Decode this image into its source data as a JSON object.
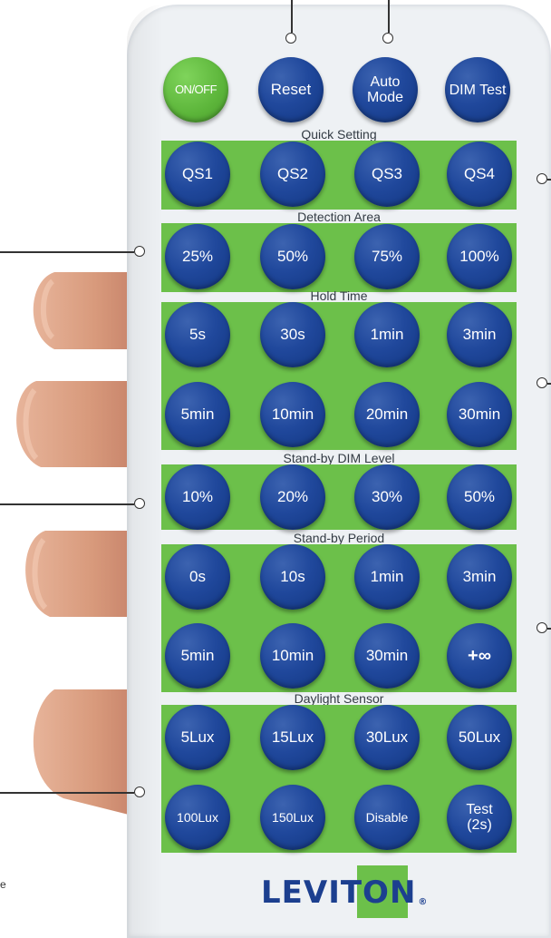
{
  "top_row": [
    {
      "label": "ON/OFF",
      "style": "green"
    },
    {
      "label": "Reset",
      "style": "blue"
    },
    {
      "label": "Auto Mode",
      "style": "blue"
    },
    {
      "label": "DIM Test",
      "style": "blue"
    }
  ],
  "sections": {
    "quick_setting": {
      "title": "Quick Setting",
      "buttons": [
        "QS1",
        "QS2",
        "QS3",
        "QS4"
      ]
    },
    "detection_area": {
      "title": "Detection Area",
      "buttons": [
        "25%",
        "50%",
        "75%",
        "100%"
      ]
    },
    "hold_time": {
      "title": "Hold Time",
      "buttons": [
        "5s",
        "30s",
        "1min",
        "3min",
        "5min",
        "10min",
        "20min",
        "30min"
      ]
    },
    "standby_dim_level": {
      "title": "Stand-by DIM Level",
      "buttons": [
        "10%",
        "20%",
        "30%",
        "50%"
      ]
    },
    "standby_period": {
      "title": "Stand-by Period",
      "buttons": [
        "0s",
        "10s",
        "1min",
        "3min",
        "5min",
        "10min",
        "30min",
        "+∞"
      ]
    },
    "daylight_sensor": {
      "title": "Daylight Sensor",
      "buttons": [
        "5Lux",
        "15Lux",
        "30Lux",
        "50Lux",
        "100Lux",
        "150Lux",
        "Disable",
        "Test (2s)"
      ]
    }
  },
  "brand": {
    "name": "LEVITON",
    "mark": "®"
  },
  "side_text": "e",
  "colors": {
    "panel_green": "#6cc04a",
    "button_blue": "#1f4699",
    "onoff_green": "#5cb53a",
    "logo_blue": "#1c3f8f",
    "remote_body": "#eef1f4"
  }
}
